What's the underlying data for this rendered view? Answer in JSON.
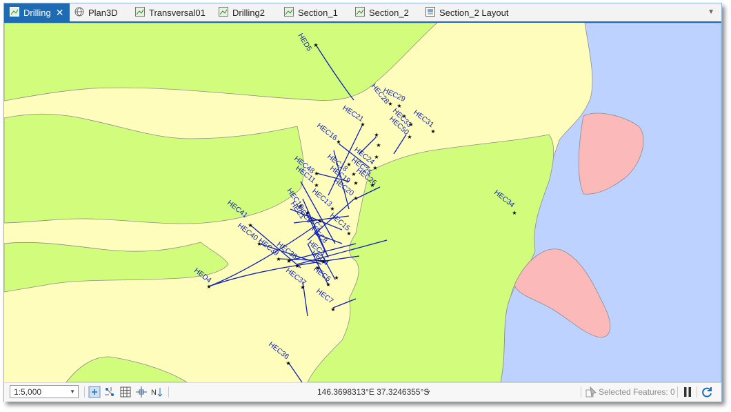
{
  "tabs": [
    {
      "label": "Drilling",
      "icon": "map-view-icon",
      "active": true,
      "closable": true
    },
    {
      "label": "Plan3D",
      "icon": "globe-scene-icon"
    },
    {
      "label": "Transversal01",
      "icon": "map-view-icon"
    },
    {
      "label": "Drilling2",
      "icon": "map-view-icon"
    },
    {
      "label": "Section_1",
      "icon": "map-view-icon"
    },
    {
      "label": "Section_2",
      "icon": "map-view-icon"
    },
    {
      "label": "Section_2 Layout",
      "icon": "layout-icon"
    }
  ],
  "map": {
    "colors": {
      "yellow_zone": "#fefdbc",
      "green_zone": "#d2fc7c",
      "water": "#bed2ff",
      "pink_zone": "#fcb9b9",
      "drill_trace": "#0d1fb8",
      "label": "#0d1fb8"
    },
    "drillholes": [
      "HED5",
      "HEC29",
      "HEC28",
      "HEC33",
      "HEC50",
      "HEC31",
      "HEC21",
      "HEC16",
      "HEC24",
      "HEC25",
      "HEC18",
      "HEC48",
      "HEC19",
      "HEC11",
      "HEC20",
      "HEC26",
      "HEC13",
      "HEC10",
      "HEC1",
      "HEC9",
      "HEC2",
      "HEC15",
      "HEC41",
      "HEC40",
      "HEC39",
      "HEC38",
      "HEC3",
      "HEC8",
      "HEC6",
      "HEC37",
      "HEC4",
      "HED4",
      "HEC7",
      "HEC34",
      "HEC36"
    ]
  },
  "statusbar": {
    "scale": "1:5,000",
    "coordinates": "146.3698313°E 37.3246355°S",
    "selected_features": "Selected Features: 0"
  }
}
